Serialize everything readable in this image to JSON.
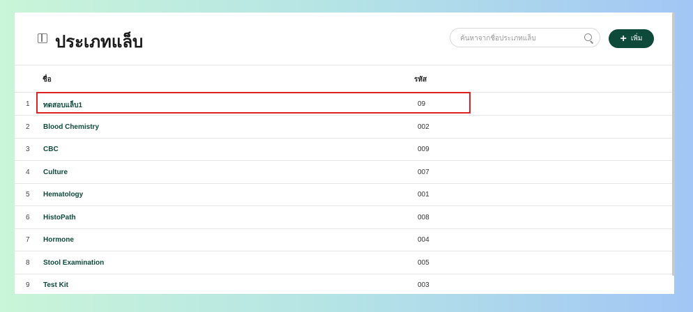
{
  "header": {
    "title": "ประเภทแล็บ",
    "search_placeholder": "ค้นหาจากชื่อประเภทแล็บ",
    "add_label": "เพิ่ม"
  },
  "table": {
    "columns": {
      "name": "ชื่อ",
      "code": "รหัส"
    },
    "rows": [
      {
        "index": "1",
        "name": "ทดสอบแล็บ1",
        "code": "09"
      },
      {
        "index": "2",
        "name": "Blood Chemistry",
        "code": "002"
      },
      {
        "index": "3",
        "name": "CBC",
        "code": "009"
      },
      {
        "index": "4",
        "name": "Culture",
        "code": "007"
      },
      {
        "index": "5",
        "name": "Hematology",
        "code": "001"
      },
      {
        "index": "6",
        "name": "HistoPath",
        "code": "008"
      },
      {
        "index": "7",
        "name": "Hormone",
        "code": "004"
      },
      {
        "index": "8",
        "name": "Stool Examination",
        "code": "005"
      },
      {
        "index": "9",
        "name": "Test Kit",
        "code": "003"
      }
    ]
  },
  "colors": {
    "accent": "#0d4a3a",
    "highlight": "#e02020"
  },
  "icons": {
    "page": "sidebar-panel-icon",
    "search": "search-icon",
    "add": "plus-icon"
  }
}
